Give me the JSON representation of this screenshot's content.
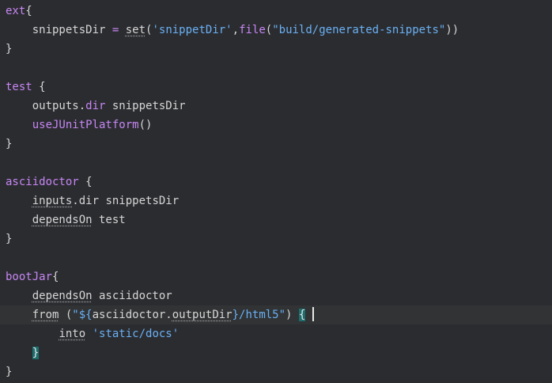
{
  "lines": {
    "l1": {
      "kw": "ext",
      "rest": "{"
    },
    "l2": {
      "indent": "    ",
      "name": "snippetsDir",
      "eq": " = ",
      "set": "set",
      "open": "(",
      "str1": "'snippetDir'",
      "comma": ",",
      "file": "file",
      "open2": "(",
      "str2": "\"build/generated-snippets\"",
      "close": "))"
    },
    "l3": {
      "text": "}"
    },
    "l5": {
      "kw": "test",
      "rest": " {"
    },
    "l6": {
      "indent": "    ",
      "a": "outputs.",
      "dir": "dir",
      "b": " snippetsDir"
    },
    "l7": {
      "indent": "    ",
      "fn": "useJUnitPlatform",
      "b": "()"
    },
    "l8": {
      "text": "}"
    },
    "l10": {
      "kw": "asciidoctor",
      "rest": " {"
    },
    "l11": {
      "indent": "    ",
      "inputs": "inputs",
      "b": ".dir snippetsDir"
    },
    "l12": {
      "indent": "    ",
      "dependsOn": "dependsOn",
      "b": " test"
    },
    "l13": {
      "text": "}"
    },
    "l15": {
      "kw": "bootJar",
      "rest": "{"
    },
    "l16": {
      "indent": "    ",
      "dependsOn": "dependsOn",
      "b": " asciidoctor"
    },
    "l17": {
      "indent": "    ",
      "from": "from",
      "a": " (",
      "str_a": "\"${",
      "ref": "asciidoctor.",
      "outputDir": "outputDir",
      "str_b": "}/html5\"",
      "b": ") ",
      "brace": "{"
    },
    "l18": {
      "indent": "        ",
      "into": "into",
      "sp": " ",
      "str": "'static/docs'"
    },
    "l19": {
      "indent": "    ",
      "brace": "}"
    },
    "l20": {
      "text": "}"
    }
  },
  "colors": {
    "background": "#2b2c30",
    "current_line": "#313335",
    "keyword": "#c686f3",
    "string": "#6ab0f3",
    "plain": "#d6d6d6",
    "brace_match": "#1f6e6e"
  }
}
